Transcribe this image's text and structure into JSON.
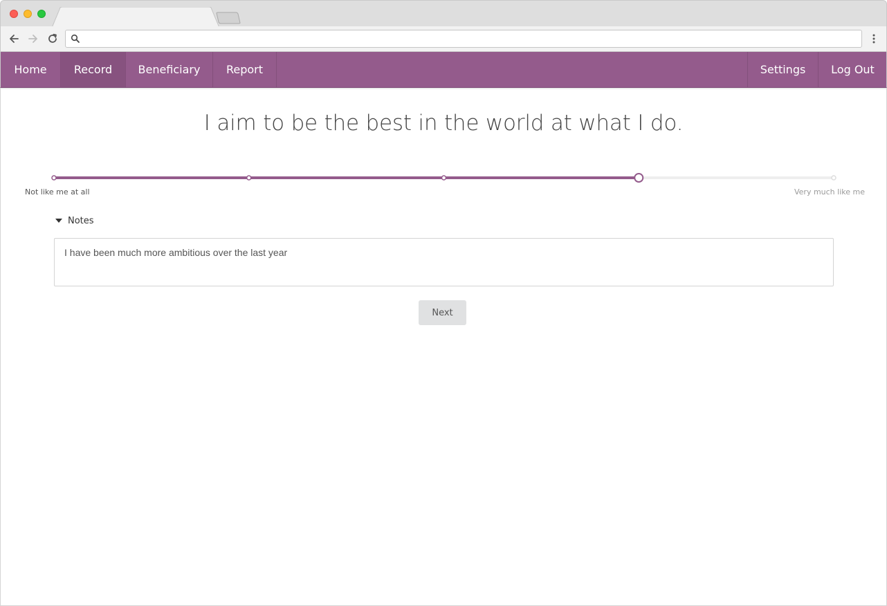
{
  "browser": {
    "tab_title": "",
    "address": {
      "value": "",
      "placeholder": ""
    }
  },
  "nav": {
    "items": [
      {
        "label": "Home",
        "active": false
      },
      {
        "label": "Record",
        "active": true
      },
      {
        "label": "Beneficiary",
        "active": false
      },
      {
        "label": "Report",
        "active": false
      }
    ],
    "right_items": [
      {
        "label": "Settings"
      },
      {
        "label": "Log Out"
      }
    ]
  },
  "question": {
    "text": "I aim to be the best in the world at what I do."
  },
  "scale": {
    "min_label": "Not like me at all",
    "max_label": "Very much like me",
    "points": 5,
    "selected_index": 3
  },
  "notes": {
    "toggle_label": "Notes",
    "value": "I have been much more ambitious over the last year"
  },
  "actions": {
    "next_label": "Next"
  },
  "colors": {
    "brand": "#945b8c",
    "brand_active": "#87527f",
    "track_empty": "#eeeeee",
    "button_bg": "#e0e1e2"
  }
}
